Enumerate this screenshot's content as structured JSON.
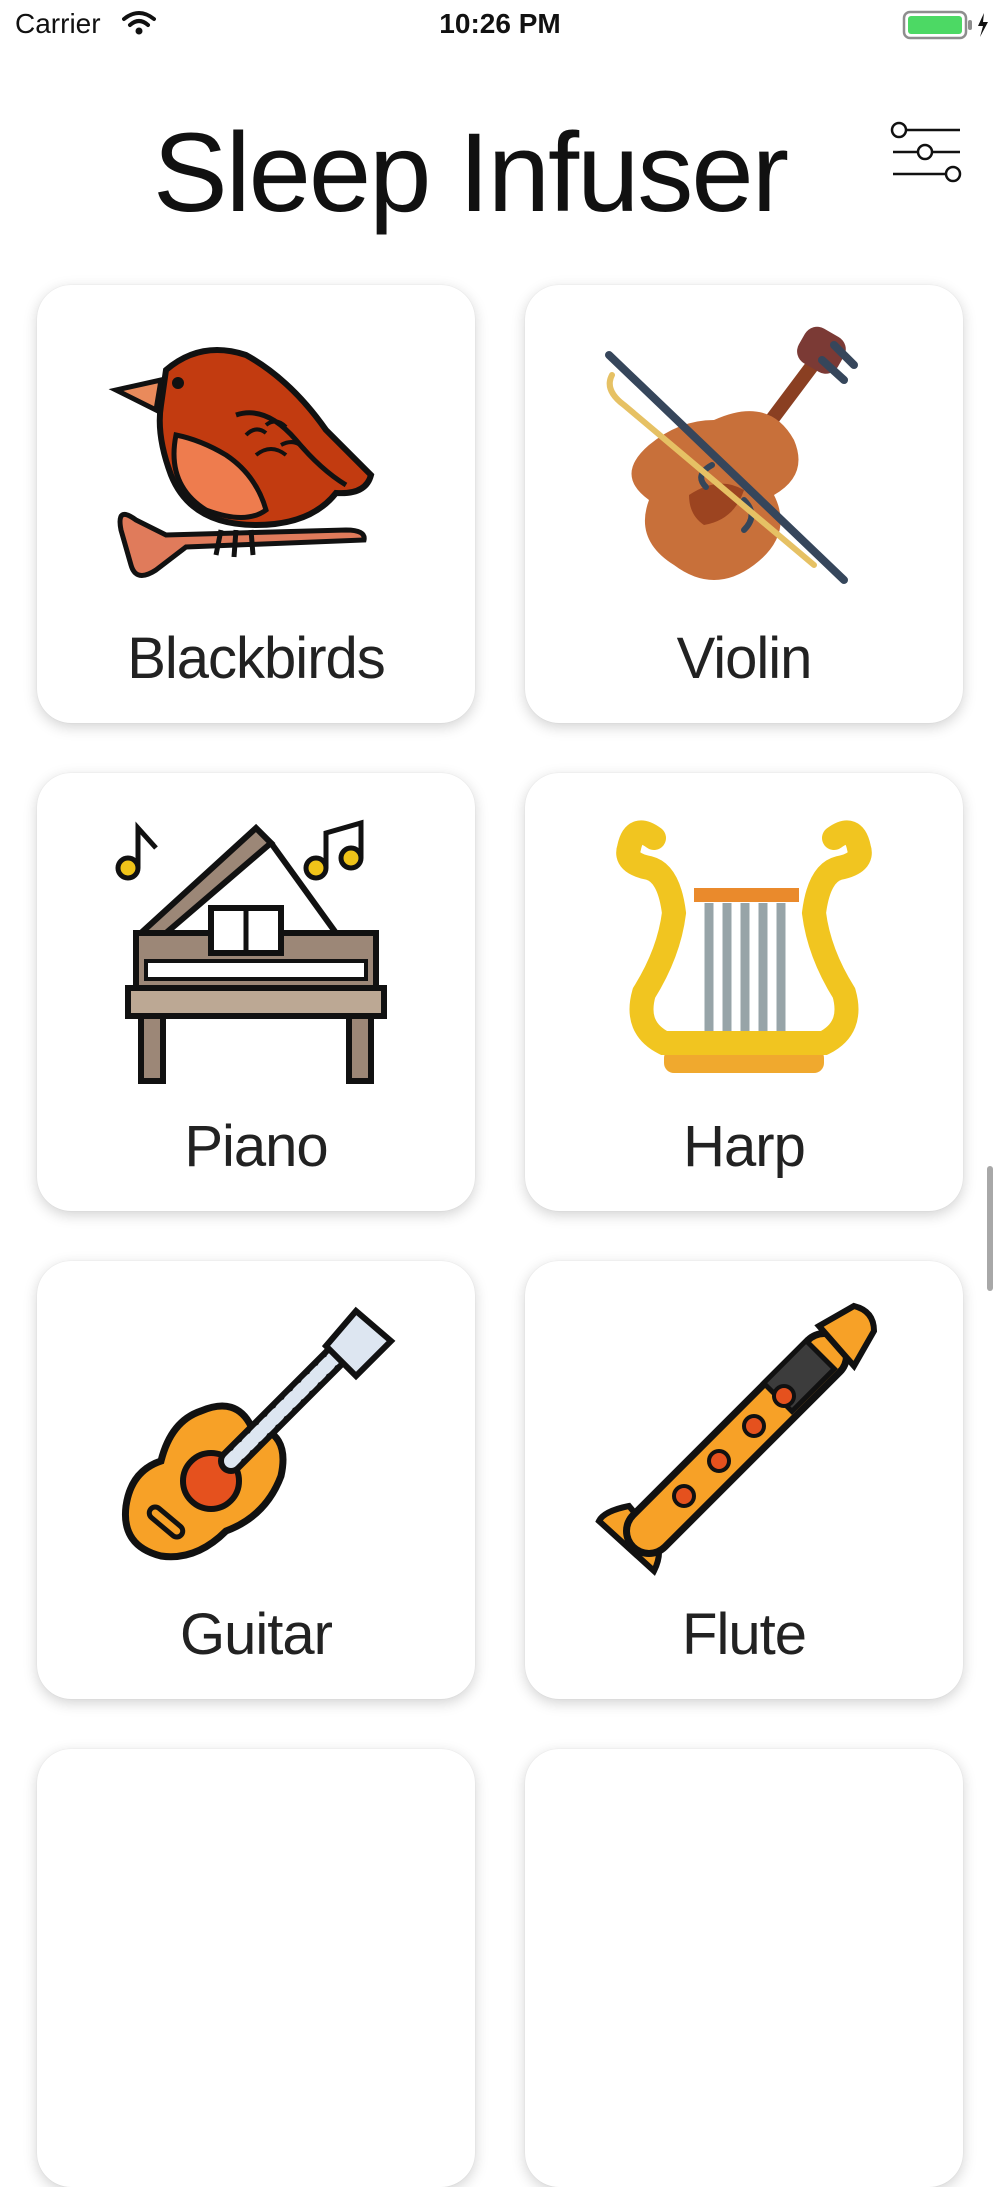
{
  "status_bar": {
    "carrier": "Carrier",
    "time": "10:26 PM",
    "battery_color": "#4cd964"
  },
  "header": {
    "title": "Sleep Infuser",
    "settings_icon": "sliders-icon"
  },
  "sounds": [
    {
      "label": "Blackbirds",
      "icon": "blackbird-icon"
    },
    {
      "label": "Violin",
      "icon": "violin-icon"
    },
    {
      "label": "Piano",
      "icon": "piano-icon"
    },
    {
      "label": "Harp",
      "icon": "harp-icon"
    },
    {
      "label": "Guitar",
      "icon": "guitar-icon"
    },
    {
      "label": "Flute",
      "icon": "flute-icon"
    }
  ]
}
